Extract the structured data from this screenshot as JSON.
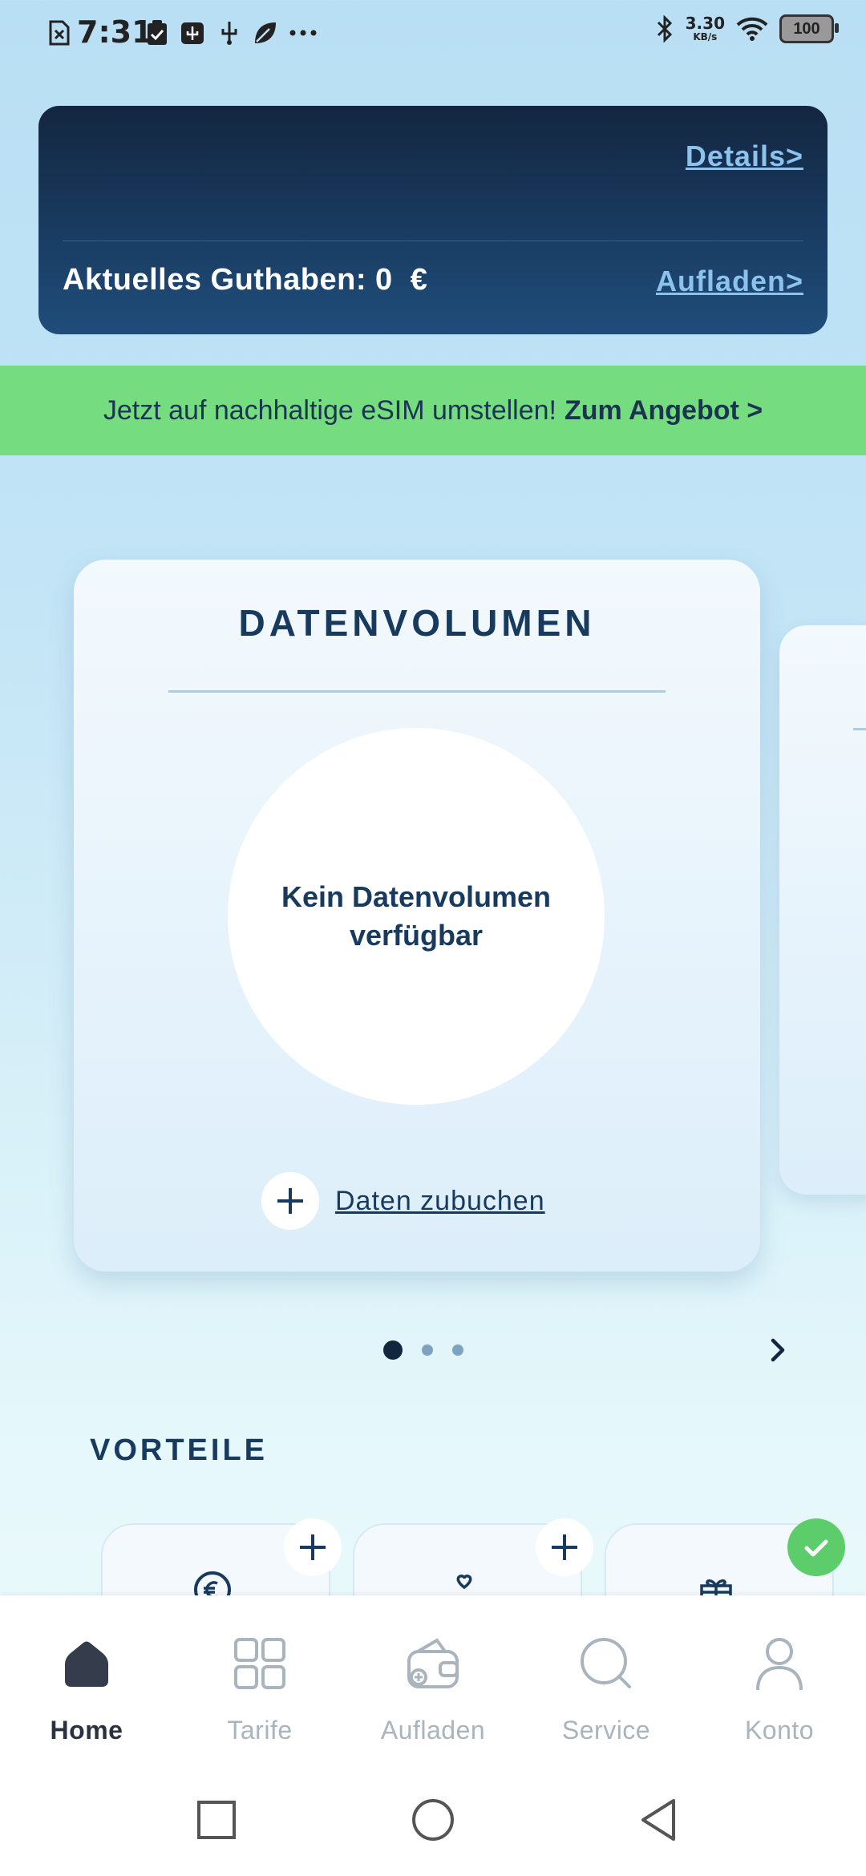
{
  "status_bar": {
    "time": "7:31",
    "net_speed": "3.30",
    "net_unit": "KB/s",
    "battery": "100",
    "icons": [
      "sim-off-icon",
      "clipboard-check-icon",
      "usb-storage-icon",
      "usb-icon",
      "leaf-icon",
      "more-icon",
      "bluetooth-icon",
      "wifi-icon",
      "battery-icon"
    ]
  },
  "balance_card": {
    "details_link": "Details>",
    "balance_text": "Aktuelles Guthaben: 0  €",
    "topup_link": "Aufladen>"
  },
  "promo": {
    "text": "Jetzt auf nachhaltige eSIM umstellen!",
    "cta": "Zum Angebot >"
  },
  "data_card": {
    "title": "DATENVOLUMEN",
    "circle_text": "Kein Datenvolumen verfügbar",
    "add_label": "Daten zubuchen"
  },
  "pager": {
    "pages": 3,
    "active_index": 0
  },
  "benefits": {
    "title": "VORTEILE",
    "items": [
      {
        "icon": "euro-coin-icon",
        "badge": "plus"
      },
      {
        "icon": "heart-hand-icon",
        "badge": "plus"
      },
      {
        "icon": "gift-icon",
        "badge": "check"
      }
    ]
  },
  "bottom_nav": {
    "items": [
      {
        "label": "Home",
        "icon": "home-icon",
        "active": true
      },
      {
        "label": "Tarife",
        "icon": "grid-icon",
        "active": false
      },
      {
        "label": "Aufladen",
        "icon": "wallet-icon",
        "active": false
      },
      {
        "label": "Service",
        "icon": "search-icon",
        "active": false
      },
      {
        "label": "Konto",
        "icon": "person-icon",
        "active": false
      }
    ]
  },
  "colors": {
    "card_dark": "#132640",
    "link": "#8cc2ee",
    "promo_green": "#76dc80",
    "text_navy": "#173a5e",
    "check_green": "#5ccd6a"
  }
}
